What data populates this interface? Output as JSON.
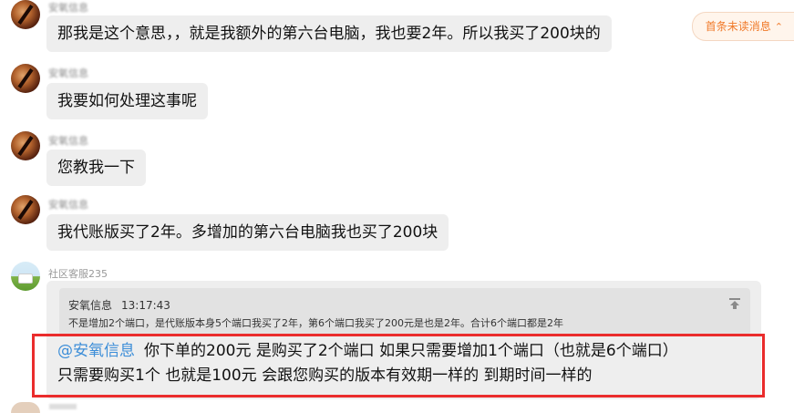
{
  "unread_badge": {
    "label": "首条未读消息",
    "chevron": "⌃"
  },
  "messages": [
    {
      "sender": "安氧信息",
      "text": "那我是这个意思，，就是我额外的第六台电脑，我也要2年。所以我买了200块的"
    },
    {
      "sender": "安氧信息",
      "text": "我要如何处理这事呢"
    },
    {
      "sender": "安氧信息",
      "text": "您教我一下"
    },
    {
      "sender": "安氧信息",
      "text": "我代账版买了2年。多增加的第六台电脑我也买了200块"
    }
  ],
  "reply": {
    "sender": "社区客服235",
    "quote": {
      "name": "安氧信息",
      "time": "13:17:43",
      "text": "不是增加2个端口，是代账版本身5个端口我买了2年，第6个端口我买了200元是也是2年。合计6个端口都是2年"
    },
    "mention": "@安氧信息",
    "line1": "你下单的200元  是购买了2个端口  如果只需要增加1个端口（也就是6个端口）",
    "line2": "只需要购买1个  也就是100元  会跟您购买的版本有效期一样的  到期时间一样的"
  },
  "colors": {
    "bubble": "#eeeeee",
    "mention": "#3d8ed8",
    "highlight": "#ea2c2c",
    "unread_badge": "#f07a2a"
  }
}
